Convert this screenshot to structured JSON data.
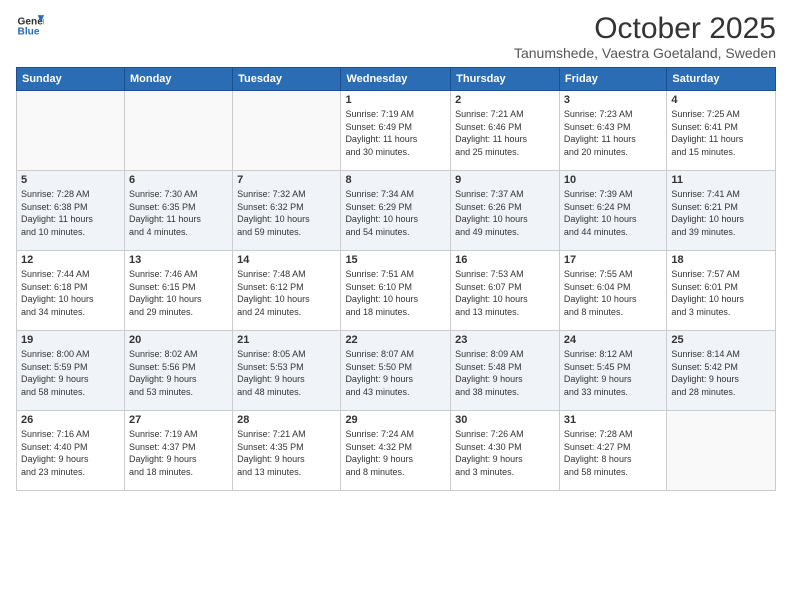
{
  "logo": {
    "line1": "General",
    "line2": "Blue"
  },
  "title": "October 2025",
  "location": "Tanumshede, Vaestra Goetaland, Sweden",
  "days_of_week": [
    "Sunday",
    "Monday",
    "Tuesday",
    "Wednesday",
    "Thursday",
    "Friday",
    "Saturday"
  ],
  "weeks": [
    [
      {
        "day": "",
        "info": ""
      },
      {
        "day": "",
        "info": ""
      },
      {
        "day": "",
        "info": ""
      },
      {
        "day": "1",
        "info": "Sunrise: 7:19 AM\nSunset: 6:49 PM\nDaylight: 11 hours\nand 30 minutes."
      },
      {
        "day": "2",
        "info": "Sunrise: 7:21 AM\nSunset: 6:46 PM\nDaylight: 11 hours\nand 25 minutes."
      },
      {
        "day": "3",
        "info": "Sunrise: 7:23 AM\nSunset: 6:43 PM\nDaylight: 11 hours\nand 20 minutes."
      },
      {
        "day": "4",
        "info": "Sunrise: 7:25 AM\nSunset: 6:41 PM\nDaylight: 11 hours\nand 15 minutes."
      }
    ],
    [
      {
        "day": "5",
        "info": "Sunrise: 7:28 AM\nSunset: 6:38 PM\nDaylight: 11 hours\nand 10 minutes."
      },
      {
        "day": "6",
        "info": "Sunrise: 7:30 AM\nSunset: 6:35 PM\nDaylight: 11 hours\nand 4 minutes."
      },
      {
        "day": "7",
        "info": "Sunrise: 7:32 AM\nSunset: 6:32 PM\nDaylight: 10 hours\nand 59 minutes."
      },
      {
        "day": "8",
        "info": "Sunrise: 7:34 AM\nSunset: 6:29 PM\nDaylight: 10 hours\nand 54 minutes."
      },
      {
        "day": "9",
        "info": "Sunrise: 7:37 AM\nSunset: 6:26 PM\nDaylight: 10 hours\nand 49 minutes."
      },
      {
        "day": "10",
        "info": "Sunrise: 7:39 AM\nSunset: 6:24 PM\nDaylight: 10 hours\nand 44 minutes."
      },
      {
        "day": "11",
        "info": "Sunrise: 7:41 AM\nSunset: 6:21 PM\nDaylight: 10 hours\nand 39 minutes."
      }
    ],
    [
      {
        "day": "12",
        "info": "Sunrise: 7:44 AM\nSunset: 6:18 PM\nDaylight: 10 hours\nand 34 minutes."
      },
      {
        "day": "13",
        "info": "Sunrise: 7:46 AM\nSunset: 6:15 PM\nDaylight: 10 hours\nand 29 minutes."
      },
      {
        "day": "14",
        "info": "Sunrise: 7:48 AM\nSunset: 6:12 PM\nDaylight: 10 hours\nand 24 minutes."
      },
      {
        "day": "15",
        "info": "Sunrise: 7:51 AM\nSunset: 6:10 PM\nDaylight: 10 hours\nand 18 minutes."
      },
      {
        "day": "16",
        "info": "Sunrise: 7:53 AM\nSunset: 6:07 PM\nDaylight: 10 hours\nand 13 minutes."
      },
      {
        "day": "17",
        "info": "Sunrise: 7:55 AM\nSunset: 6:04 PM\nDaylight: 10 hours\nand 8 minutes."
      },
      {
        "day": "18",
        "info": "Sunrise: 7:57 AM\nSunset: 6:01 PM\nDaylight: 10 hours\nand 3 minutes."
      }
    ],
    [
      {
        "day": "19",
        "info": "Sunrise: 8:00 AM\nSunset: 5:59 PM\nDaylight: 9 hours\nand 58 minutes."
      },
      {
        "day": "20",
        "info": "Sunrise: 8:02 AM\nSunset: 5:56 PM\nDaylight: 9 hours\nand 53 minutes."
      },
      {
        "day": "21",
        "info": "Sunrise: 8:05 AM\nSunset: 5:53 PM\nDaylight: 9 hours\nand 48 minutes."
      },
      {
        "day": "22",
        "info": "Sunrise: 8:07 AM\nSunset: 5:50 PM\nDaylight: 9 hours\nand 43 minutes."
      },
      {
        "day": "23",
        "info": "Sunrise: 8:09 AM\nSunset: 5:48 PM\nDaylight: 9 hours\nand 38 minutes."
      },
      {
        "day": "24",
        "info": "Sunrise: 8:12 AM\nSunset: 5:45 PM\nDaylight: 9 hours\nand 33 minutes."
      },
      {
        "day": "25",
        "info": "Sunrise: 8:14 AM\nSunset: 5:42 PM\nDaylight: 9 hours\nand 28 minutes."
      }
    ],
    [
      {
        "day": "26",
        "info": "Sunrise: 7:16 AM\nSunset: 4:40 PM\nDaylight: 9 hours\nand 23 minutes."
      },
      {
        "day": "27",
        "info": "Sunrise: 7:19 AM\nSunset: 4:37 PM\nDaylight: 9 hours\nand 18 minutes."
      },
      {
        "day": "28",
        "info": "Sunrise: 7:21 AM\nSunset: 4:35 PM\nDaylight: 9 hours\nand 13 minutes."
      },
      {
        "day": "29",
        "info": "Sunrise: 7:24 AM\nSunset: 4:32 PM\nDaylight: 9 hours\nand 8 minutes."
      },
      {
        "day": "30",
        "info": "Sunrise: 7:26 AM\nSunset: 4:30 PM\nDaylight: 9 hours\nand 3 minutes."
      },
      {
        "day": "31",
        "info": "Sunrise: 7:28 AM\nSunset: 4:27 PM\nDaylight: 8 hours\nand 58 minutes."
      },
      {
        "day": "",
        "info": ""
      }
    ]
  ]
}
